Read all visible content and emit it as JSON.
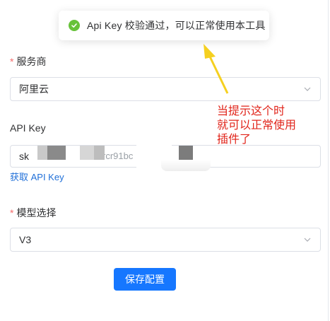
{
  "toast": {
    "icon": "check-circle-icon",
    "message": "Api Key 校验通过，可以正常使用本工具",
    "color": "#67c23a"
  },
  "form": {
    "provider": {
      "label": "服务商",
      "required_mark": "*",
      "value": "阿里云"
    },
    "api_key": {
      "label": "API Key",
      "value_visible_prefix": "sk",
      "value_visible_fragment": "rcr91bc",
      "get_key_link": "获取 API Key"
    },
    "model": {
      "label": "模型选择",
      "required_mark": "*",
      "value": "V3"
    },
    "save_button": "保存配置"
  },
  "annotation": {
    "lines": [
      "当提示这个时",
      "就可以正常使用",
      "插件了"
    ],
    "color": "#e1251b",
    "arrow_color": "#f5d020"
  },
  "colors": {
    "primary": "#1677ff",
    "link": "#1f6fd8",
    "required": "#f56c6c",
    "border": "#dcdfe6"
  }
}
